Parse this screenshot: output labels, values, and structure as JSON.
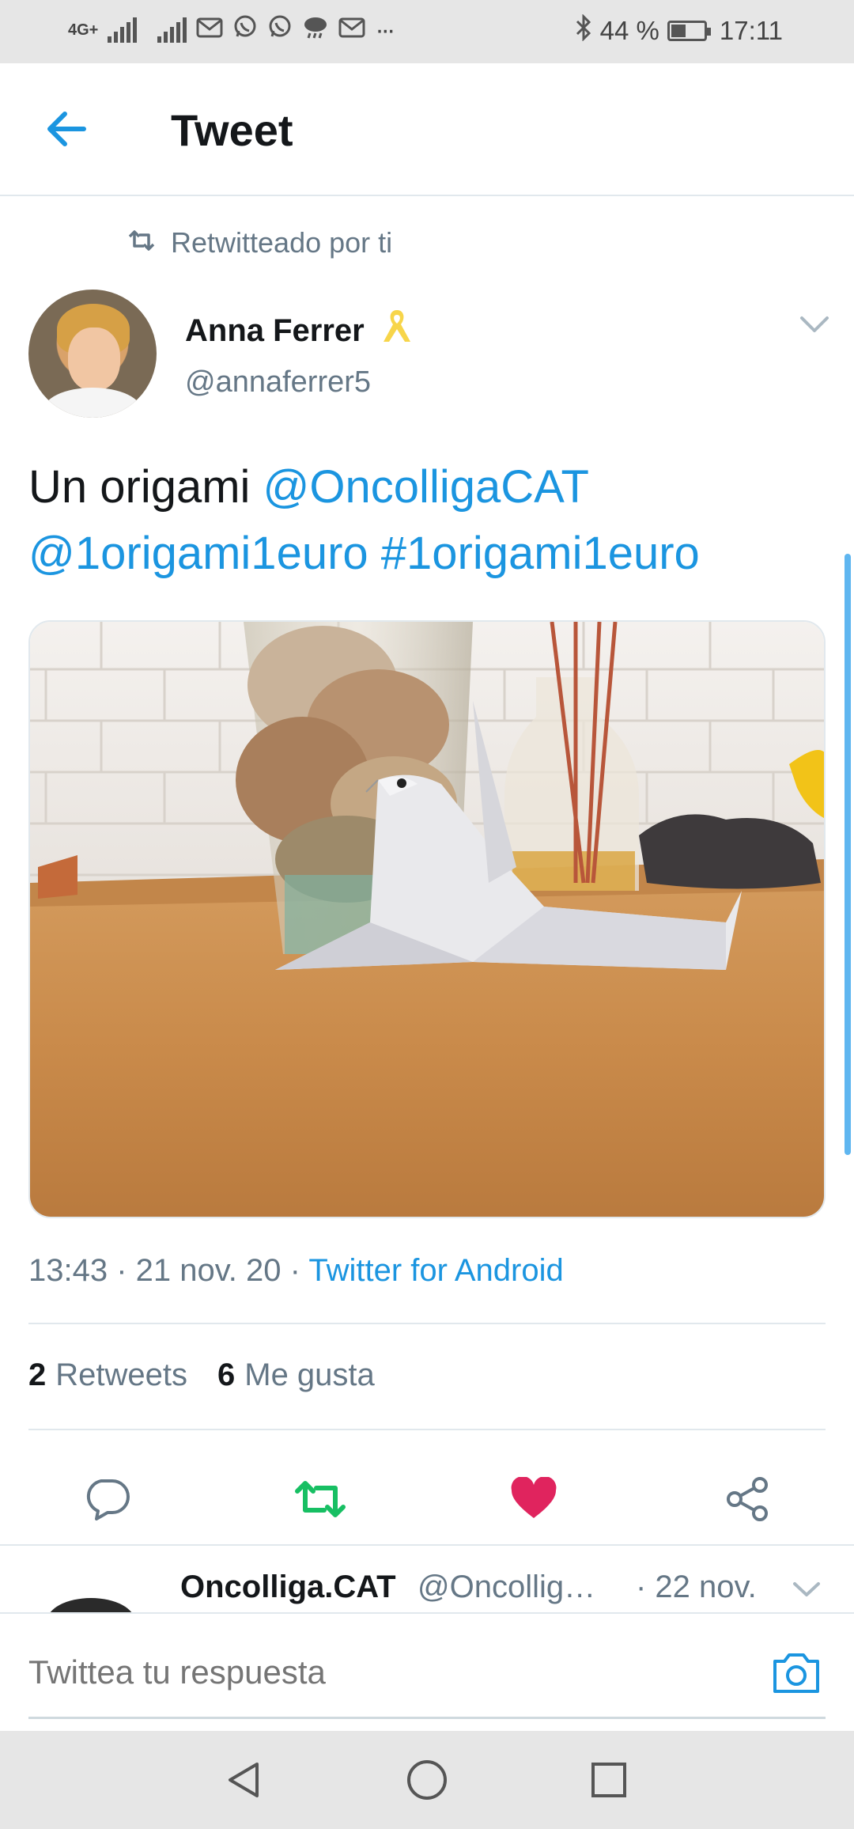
{
  "status_bar": {
    "network": "4G+",
    "battery_percent": "44 %",
    "time": "17:11",
    "icons": [
      "signal-icon",
      "signal-icon",
      "gmail-icon",
      "whatsapp-icon",
      "whatsapp-icon",
      "weather-icon",
      "gmail-icon",
      "more-icon",
      "bluetooth-icon",
      "battery-icon"
    ],
    "more": "···"
  },
  "header": {
    "title": "Tweet",
    "back_icon": "arrow-left-icon"
  },
  "retweet": {
    "label": "Retwitteado por ti",
    "icon": "retweet-icon"
  },
  "author": {
    "name": "Anna Ferrer",
    "handle": "@annaferrer5",
    "badge_icon": "yellow-ribbon-icon"
  },
  "tweet": {
    "text_plain": "Un origami ",
    "mention_1": "@OncolligaCAT",
    "mention_2": "@1origami1euro",
    "hashtag": "#1origami1euro"
  },
  "meta": {
    "time": "13:43",
    "sep1": " · ",
    "date": "21 nov. 20",
    "sep2": " · ",
    "source": "Twitter for Android"
  },
  "stats": {
    "retweets_count": "2",
    "retweets_label": "Retweets",
    "likes_count": "6",
    "likes_label": "Me gusta"
  },
  "actions": {
    "reply_icon": "reply-icon",
    "retweet_icon": "retweet-icon",
    "like_icon": "heart-icon",
    "share_icon": "share-icon",
    "retweeted": true,
    "liked": true
  },
  "reply_preview": {
    "name": "Oncolliga.CAT",
    "handle": "@Oncollig…",
    "date": "· 22 nov."
  },
  "compose": {
    "placeholder": "Twittea tu respuesta"
  },
  "colors": {
    "accent": "#1b95e0",
    "retweet_green": "#17bf63",
    "like_red": "#e0245e",
    "secondary_text": "#657786"
  }
}
